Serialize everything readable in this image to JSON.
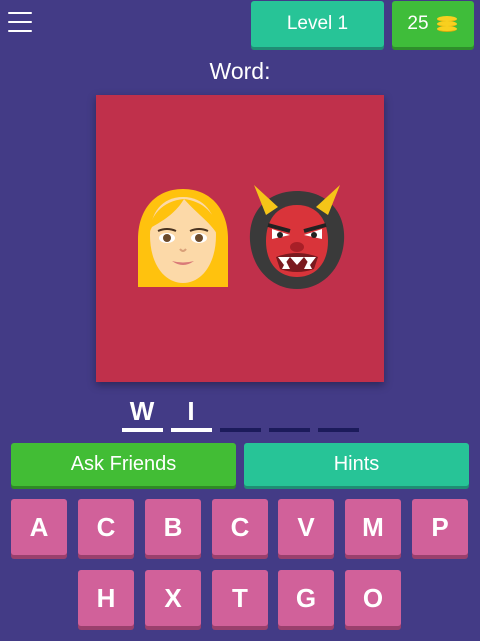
{
  "header": {
    "level_label": "Level 1",
    "coins": "25",
    "menu_icon": "hamburger-menu-icon",
    "coin_icon": "coin-stack-icon"
  },
  "title": "Word:",
  "puzzle": {
    "background_color": "#c0304b",
    "emojis": [
      "woman-blonde-face",
      "japanese-ogre-oni"
    ]
  },
  "answer_slots": [
    {
      "letter": "W",
      "filled": true
    },
    {
      "letter": "I",
      "filled": true
    },
    {
      "letter": "",
      "filled": false
    },
    {
      "letter": "",
      "filled": false
    },
    {
      "letter": "",
      "filled": false
    }
  ],
  "actions": {
    "ask_friends": "Ask Friends",
    "hints": "Hints"
  },
  "keyboard": {
    "row1": [
      "A",
      "C",
      "B",
      "C",
      "V",
      "M",
      "P"
    ],
    "row2": [
      "H",
      "X",
      "T",
      "G",
      "O"
    ]
  },
  "colors": {
    "background": "#433b86",
    "green": "#42bd35",
    "teal": "#27c497",
    "key": "#d1619a"
  }
}
